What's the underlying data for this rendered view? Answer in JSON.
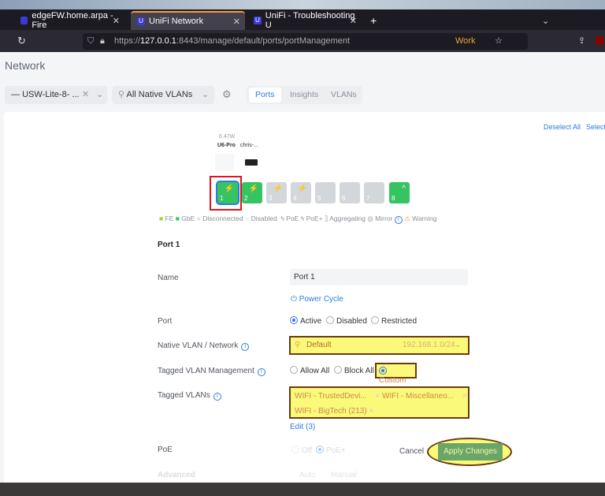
{
  "browser": {
    "tabs": [
      {
        "title": "edgeFW.home.arpa - Fire"
      },
      {
        "title": "UniFi Network",
        "active": true
      },
      {
        "title": "UniFi - Troubleshooting U"
      }
    ],
    "url_prefix": "https://",
    "url_host": "127.0.0.1",
    "url_rest": ":8443/manage/default/ports/portManagement",
    "container_label": "Work"
  },
  "header": {
    "title": "Network"
  },
  "toolbar": {
    "device": "USW-Lite-8- ...",
    "vlan_filter": "All Native VLANs",
    "tabs": [
      "Ports",
      "Insights",
      "VLANs"
    ],
    "active_tab": "Ports"
  },
  "ports": {
    "deselect_all": "Deselect All",
    "select_all": "Select",
    "devices": [
      {
        "power": "6.47W",
        "name": "U6-Pro"
      },
      {
        "power": "",
        "name": "chris-..."
      }
    ],
    "items": [
      {
        "n": "1",
        "status": "GbE",
        "poe": true,
        "selected": true
      },
      {
        "n": "2",
        "status": "GbE",
        "poe": true
      },
      {
        "n": "3",
        "status": "Disconnected",
        "poe": true
      },
      {
        "n": "4",
        "status": "Disconnected",
        "poe": true
      },
      {
        "n": "5",
        "status": "Disconnected"
      },
      {
        "n": "6",
        "status": "Disconnected"
      },
      {
        "n": "7",
        "status": "Disconnected"
      },
      {
        "n": "8",
        "status": "GbE",
        "uplink": true
      }
    ],
    "legend": [
      "FE",
      "GbE",
      "Disconnected",
      "Disabled",
      "PoE",
      "PoE+",
      "Aggregating",
      "Mirror",
      "Warning"
    ],
    "colors": {
      "fe": "#a4d037",
      "gbe": "#36c463",
      "disconnected": "#d3d6db"
    }
  },
  "form": {
    "section_title": "Port 1",
    "name_label": "Name",
    "name_value": "Port 1",
    "power_cycle": "Power Cycle",
    "port_label": "Port",
    "port_options": [
      "Active",
      "Disabled",
      "Restricted"
    ],
    "port_selected": "Active",
    "native_label": "Native VLAN / Network",
    "native_value": "Default",
    "native_subnet": "192.168.1.0/24",
    "tagged_mgmt_label": "Tagged VLAN Management",
    "tagged_mgmt_options": [
      "Allow All",
      "Block All",
      "Custom"
    ],
    "tagged_mgmt_selected": "Custom",
    "tagged_label": "Tagged VLANs",
    "tagged_values": [
      "WIFI - TrustedDevi...",
      "WIFI - Miscellaneo...",
      "WIFI - BigTech (213)"
    ],
    "edit_label": "Edit (3)",
    "poe_label": "PoE",
    "poe_options": [
      "Off",
      "PoE+"
    ],
    "poe_selected": "PoE+",
    "advanced_label": "Advanced",
    "advanced_options": [
      "Auto",
      "Manual"
    ],
    "cancel": "Cancel",
    "apply": "Apply Changes"
  }
}
